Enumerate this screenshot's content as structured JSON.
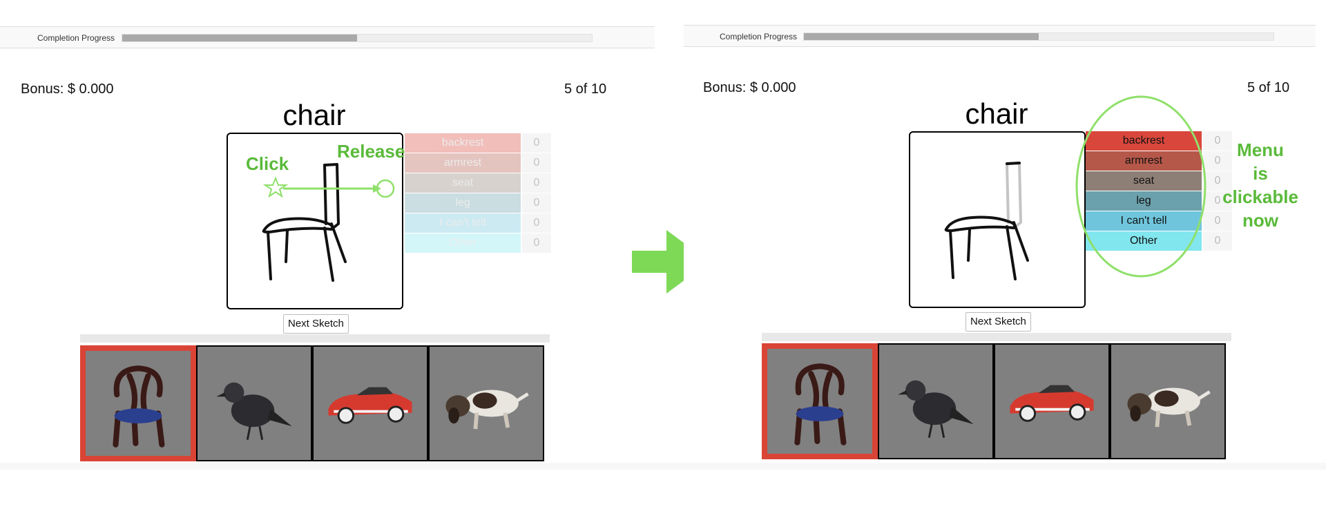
{
  "colors": {
    "backrest": "#d9473c",
    "armrest": "#b5584a",
    "seat": "#8e7f76",
    "leg": "#6aa1ac",
    "cant_tell": "#6fc6dc",
    "other": "#82e6ee",
    "annotation": "#5aba3a",
    "selected_border": "#d94436"
  },
  "left": {
    "progress_label": "Completion Progress",
    "progress_fraction": 0.5,
    "bonus": "Bonus: $ 0.000",
    "count": "5 of 10",
    "word": "chair",
    "next_label": "Next Sketch",
    "menu": [
      {
        "label": "backrest",
        "count": "0"
      },
      {
        "label": "armrest",
        "count": "0"
      },
      {
        "label": "seat",
        "count": "0"
      },
      {
        "label": "leg",
        "count": "0"
      },
      {
        "label": "I can't tell",
        "count": "0"
      },
      {
        "label": "Other",
        "count": "0"
      }
    ],
    "annotation_click": "Click",
    "annotation_release": "Release",
    "thumbnails": [
      {
        "icon": "chair-image",
        "selected": true
      },
      {
        "icon": "crow-image",
        "selected": false
      },
      {
        "icon": "car-image",
        "selected": false
      },
      {
        "icon": "dog-image",
        "selected": false
      }
    ]
  },
  "right": {
    "progress_label": "Completion Progress",
    "progress_fraction": 0.5,
    "bonus": "Bonus: $ 0.000",
    "count": "5 of 10",
    "word": "chair",
    "next_label": "Next Sketch",
    "menu": [
      {
        "label": "backrest",
        "count": "0"
      },
      {
        "label": "armrest",
        "count": "0"
      },
      {
        "label": "seat",
        "count": "0"
      },
      {
        "label": "leg",
        "count": "0"
      },
      {
        "label": "I can't tell",
        "count": "0"
      },
      {
        "label": "Other",
        "count": "0"
      }
    ],
    "annotation_menu": [
      "Menu",
      "is",
      "clickable",
      "now"
    ],
    "thumbnails": [
      {
        "icon": "chair-image",
        "selected": true
      },
      {
        "icon": "crow-image",
        "selected": false
      },
      {
        "icon": "car-image",
        "selected": false
      },
      {
        "icon": "dog-image",
        "selected": false
      }
    ]
  },
  "arrow_icon": "right-arrow-icon"
}
